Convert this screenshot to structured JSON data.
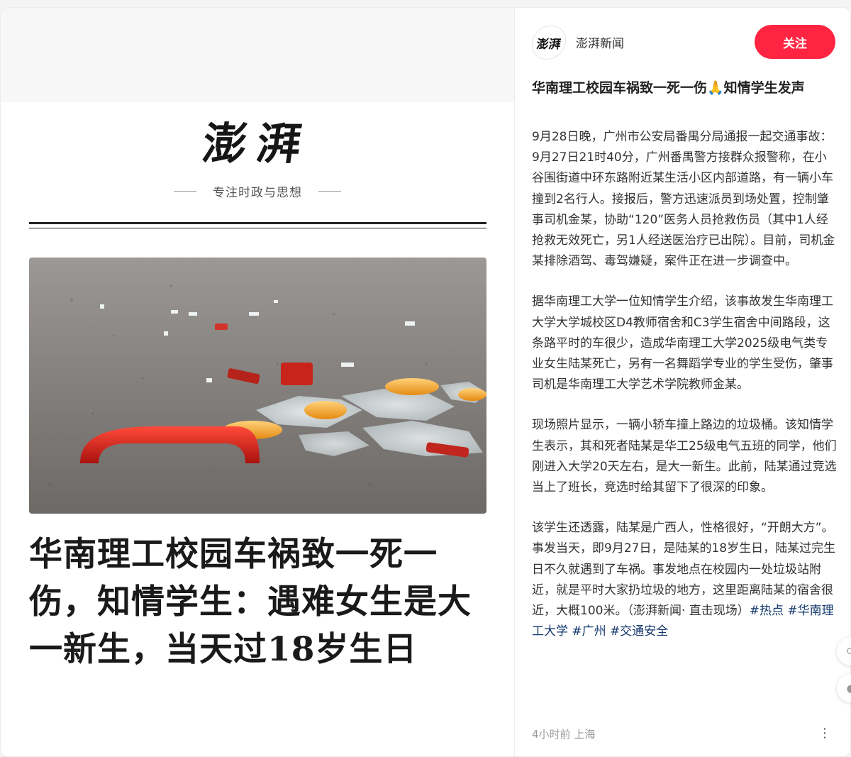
{
  "media": {
    "logo": "澎湃",
    "slogan": "专注时政与思想",
    "headline": "华南理工校园车祸致一死一伤，知情学生：遇难女生是大一新生，当天过18岁生日"
  },
  "author": {
    "avatar_text": "澎湃",
    "name": "澎湃新闻",
    "follow_label": "关注"
  },
  "post": {
    "title": "华南理工校园车祸致一死一伤🙏知情学生发声",
    "paragraphs": [
      "9月28日晚，广州市公安局番禺分局通报一起交通事故：9月27日21时40分，广州番禺警方接群众报警称，在小谷围街道中环东路附近某生活小区内部道路，有一辆小车撞到2名行人。接报后，警方迅速派员到场处置，控制肇事司机金某，协助“120”医务人员抢救伤员（其中1人经抢救无效死亡，另1人经送医治疗已出院）。目前，司机金某排除酒驾、毒驾嫌疑，案件正在进一步调查中。",
      "据华南理工大学一位知情学生介绍，该事故发生华南理工大学大学城校区D4教师宿舍和C3学生宿舍中间路段，这条路平时的车很少，造成华南理工大学2025级电气类专业女生陆某死亡，另有一名舞蹈学专业的学生受伤，肇事司机是华南理工大学艺术学院教师金某。",
      "现场照片显示，一辆小轿车撞上路边的垃圾桶。该知情学生表示，其和死者陆某是华工25级电气五班的同学，他们刚进入大学20天左右，是大一新生。此前，陆某通过竞选当上了班长，竞选时给其留下了很深的印象。"
    ],
    "last_paragraph": "该学生还透露，陆某是广西人，性格很好，“开朗大方”。事发当天，即9月27日，是陆某的18岁生日，陆某过完生日不久就遇到了车祸。事发地点在校园内一处垃圾站附近，就是平时大家扔垃圾的地方，这里距离陆某的宿舍很近，大概100米。（澎湃新闻· 直击现场）",
    "tags": [
      "#热点",
      "#华南理工大学",
      "#广州",
      "#交通安全"
    ],
    "meta": "4小时前 上海"
  },
  "icons": {
    "more": "more-dots-icon"
  },
  "colors": {
    "follow_button": "#ff2442",
    "tag": "#13386c"
  }
}
